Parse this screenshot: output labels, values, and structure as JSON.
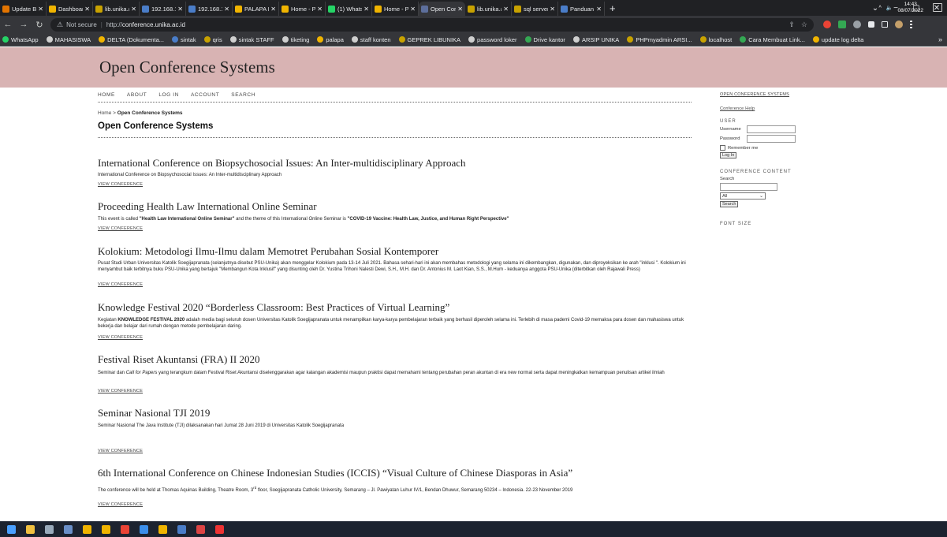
{
  "browser": {
    "tabs": [
      {
        "label": "Update Bi",
        "color": "#e37400",
        "active": false
      },
      {
        "label": "Dashboard",
        "color": "#f0b400",
        "active": false
      },
      {
        "label": "lib.unika.ac",
        "color": "#c8a200",
        "active": false
      },
      {
        "label": "192.168.15",
        "color": "#4a7dc8",
        "active": false
      },
      {
        "label": "192.168.15",
        "color": "#4a7dc8",
        "active": false
      },
      {
        "label": "PALAPA Pe",
        "color": "#f0b400",
        "active": false
      },
      {
        "label": "Home - Po",
        "color": "#f0b400",
        "active": false
      },
      {
        "label": "(1) WhatsA",
        "color": "#25d366",
        "active": false
      },
      {
        "label": "Home - Po",
        "color": "#f0b400",
        "active": false
      },
      {
        "label": "Open Conf",
        "color": "#5d6f9c",
        "active": true
      },
      {
        "label": "lib.unika.ac",
        "color": "#c8a200",
        "active": false
      },
      {
        "label": "sql server -",
        "color": "#c8a200",
        "active": false
      },
      {
        "label": "Panduan P",
        "color": "#4a7dc8",
        "active": false
      }
    ],
    "new_tab": "+",
    "window_controls": {
      "minimize": "−",
      "maximize": "▢",
      "close": "✕",
      "dropdown": "⌄"
    },
    "security": "Not secure",
    "url_scheme": "http://",
    "url_host": "conference.unika.ac.id",
    "bookmarks": [
      {
        "label": "WhatsApp",
        "color": "#25d366"
      },
      {
        "label": "MAHASISWA",
        "color": "#cfcfcf"
      },
      {
        "label": "DELTA (Dokumenta...",
        "color": "#f0b400"
      },
      {
        "label": "sintak",
        "color": "#4a7dc8"
      },
      {
        "label": "qris",
        "color": "#c8a200"
      },
      {
        "label": "sintak STAFF",
        "color": "#cfcfcf"
      },
      {
        "label": "tiketing",
        "color": "#cfcfcf"
      },
      {
        "label": "palapa",
        "color": "#f0b400"
      },
      {
        "label": "staff konten",
        "color": "#cfcfcf"
      },
      {
        "label": "GEPREK LIBUNIKA",
        "color": "#c8a200"
      },
      {
        "label": "password loker",
        "color": "#cfcfcf"
      },
      {
        "label": "Drive kantor",
        "color": "#34a853"
      },
      {
        "label": "ARSIP UNIKA",
        "color": "#cfcfcf"
      },
      {
        "label": "PHPmyadmin ARSI...",
        "color": "#c8a200"
      },
      {
        "label": "localhost",
        "color": "#c8a200"
      },
      {
        "label": "Cara Membuat Link...",
        "color": "#34a853"
      },
      {
        "label": "update log delta",
        "color": "#f0b400"
      }
    ],
    "bookmarks_more": "»"
  },
  "site": {
    "title": "Open Conference Systems",
    "nav": [
      "HOME",
      "ABOUT",
      "LOG IN",
      "ACCOUNT",
      "SEARCH"
    ],
    "breadcrumb_home": "Home",
    "breadcrumb_sep": " > ",
    "breadcrumb_current": "Open Conference Systems",
    "page_title": "Open Conference Systems"
  },
  "conferences": [
    {
      "title": "International Conference on Biopsychosocial Issues: An Inter-multidisciplinary Approach",
      "desc": "International Conference on Biopsychosocial Issues: An Inter-multidisciplinary Approach",
      "link": "VIEW CONFERENCE"
    },
    {
      "title": "Proceeding Health Law International Online Seminar",
      "desc_pre": "This event is called ",
      "desc_b1": "\"Health Law International Online Seminar\"",
      "desc_mid": " and the theme of this International Online Seminar is ",
      "desc_b2": "\"COVID-19 Vaccine: Health Law, Justice, and Human Right Perspective\"",
      "link": "VIEW CONFERENCE"
    },
    {
      "title": "Kolokium: Metodologi Ilmu-Ilmu dalam Memotret Perubahan Sosial Kontemporer",
      "desc": "Pusat Studi Urban Universitas Katolik Soegijapranata (selanjutnya disebut PSU-Unika) akan menggelar  Kolokium pada 13-14 Juli 2021. Bahasa sehari-hari ini akan membahas metodologi yang selama ini dikembangkan, digunakan, dan diproyeksikan ke arah \"inklusi \". Kolokium ini menyambut baik terbitnya buku PSU-Unika yang bertajuk \"Membangun Kota Inklusif\" yang disunting oleh Dr. Yustina Trihoni Nalesti Dewi, S.H., M.H. dan Dr. Antonius M. Laot Kian, S.S., M.Hum - keduanya anggota PSU-Unika (diterbitkan oleh Rajawali Press)",
      "link": "VIEW CONFERENCE"
    },
    {
      "title": "Knowledge Festival 2020 “Borderless Classroom: Best Practices of Virtual Learning”",
      "desc_pre": "Kegiatan ",
      "desc_b1": "KNOWLEDGE FESTIVAL 2020",
      "desc_mid": " adalah  media bagi seluruh dosen Universitas Katolik Soegijapranata untuk menampilkan karya-karya pembelajaran terbaik yang berhasil diperoleh selama ini. Terlebih di masa pademi Covid-19 memaksa para dosen dan mahasiswa untuk bekerja dan belajar dari rumah dengan metode pembelajaran daring.",
      "link": "VIEW CONFERENCE"
    },
    {
      "title": "Festival Riset Akuntansi (FRA) II 2020",
      "desc_pre": "Seminar dan ",
      "desc_i1": "Call for Papers",
      "desc_mid": " yang terangkum dalam Festival Riset Akuntansi diselenggarakan agar kalangan akademisi maupun praktisi dapat memahami tentang perubahan peran akuntan di era new normal serta dapat meningkatkan kemampuan penulisan artikel ilmiah",
      "link": "VIEW CONFERENCE"
    },
    {
      "title": "Seminar Nasional TJI 2019",
      "desc": "Seminar Nasional The Java Institute (TJI) dilaksanakan hari Jumat 28 Juni 2019 di Universitas Katolik Soegijapranata",
      "link": "VIEW CONFERENCE"
    },
    {
      "title": "6th International Conference on Chinese Indonesian Studies (ICCIS) “Visual Culture of Chinese Diasporas in Asia”",
      "desc_pre": "The conference will be held at Thomas Aquinas Building, Theatre Room, 3",
      "desc_sup": "rd",
      "desc_mid": " floor, Soegijapranata Catholic University, Semarang – Jl. Pawiyatan Luhur IV/1, Bendan Dhuwur, Semarang 50234 – Indonesia. 22-23 November 2019",
      "link": "VIEW CONFERENCE"
    }
  ],
  "sidebar": {
    "ocs_link": "OPEN CONFERENCE SYSTEMS",
    "help_link": "Conference Help",
    "user_heading": "USER",
    "username_label": "Username",
    "password_label": "Password",
    "remember_label": "Remember me",
    "login_button": "Log In",
    "content_heading": "CONFERENCE CONTENT",
    "search_label": "Search",
    "search_scope": "All",
    "search_button": "Search",
    "font_heading": "FONT SIZE"
  },
  "taskbar": {
    "icons": [
      {
        "name": "start-icon",
        "color": "#4aa0ff"
      },
      {
        "name": "file-explorer-icon",
        "color": "#f0c040"
      },
      {
        "name": "network-icon",
        "color": "#9ab"
      },
      {
        "name": "settings-icon",
        "color": "#6a8fc8"
      },
      {
        "name": "folder-icon",
        "color": "#f0b400"
      },
      {
        "name": "chrome-icon",
        "color": "#f0b400"
      },
      {
        "name": "chrome-alt-icon",
        "color": "#ea4335"
      },
      {
        "name": "vscode-icon",
        "color": "#3b8eea"
      },
      {
        "name": "app-icon",
        "color": "#f0b400"
      },
      {
        "name": "app-2-icon",
        "color": "#4a7dc8"
      },
      {
        "name": "app-3-icon",
        "color": "#d44"
      },
      {
        "name": "pdf-icon",
        "color": "#e33"
      }
    ],
    "tray_arrow": "^",
    "tray_volume": "🔈",
    "time": "14:43",
    "date": "08/07/2022"
  }
}
